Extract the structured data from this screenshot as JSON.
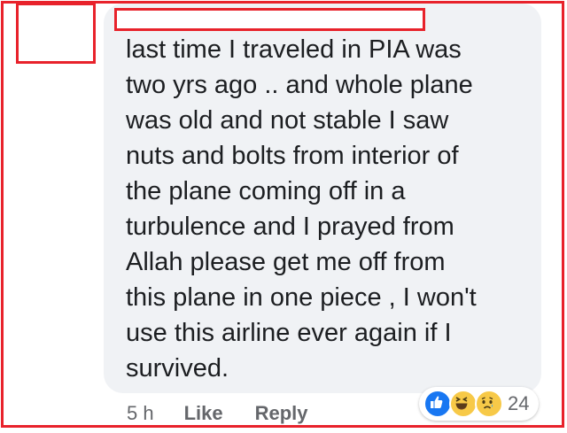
{
  "comment": {
    "text": "last time I traveled in PIA was\ntwo yrs ago .. and whole plane\nwas old and not stable I saw\nnuts and bolts from interior of\nthe plane coming off in a\nturbulence and I prayed from\nAllah please get me off from\nthis plane in one piece , I won't\nuse this airline ever again if I\nsurvived."
  },
  "actions": {
    "time": "5 h",
    "like_label": "Like",
    "reply_label": "Reply"
  },
  "reactions": {
    "icons": [
      "like-icon",
      "haha-icon",
      "sad-icon"
    ],
    "count": "24"
  },
  "colors": {
    "redaction_border": "#e8222b",
    "bubble_background": "#f0f2f5",
    "like_blue": "#1877f2",
    "emoji_yellow": "#f7c948"
  }
}
